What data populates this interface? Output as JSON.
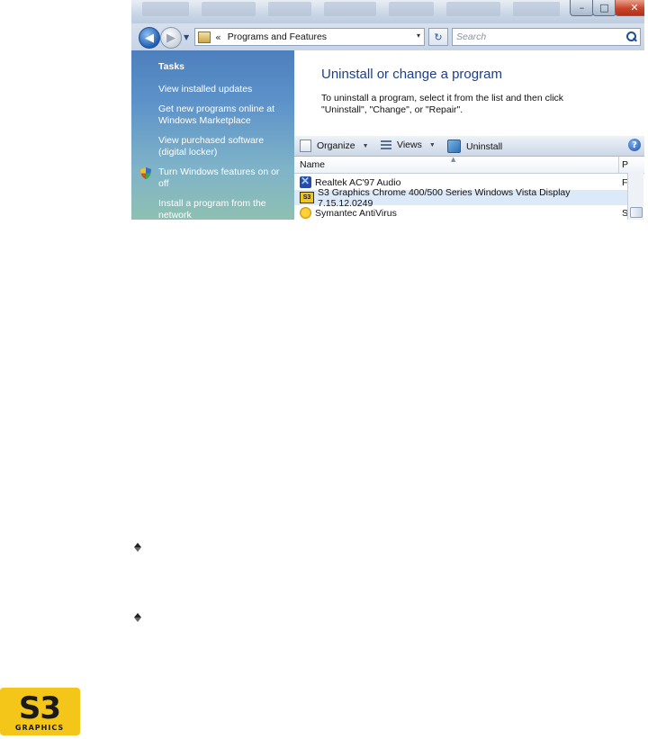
{
  "window": {
    "controls": {
      "minimize": "–",
      "maximize": "□",
      "close": "✕"
    },
    "address": {
      "separator": "«",
      "location": "Programs and Features",
      "dropdown": "▾",
      "refresh": "↻"
    },
    "search": {
      "placeholder": "Search"
    }
  },
  "sidebar": {
    "title": "Tasks",
    "links": [
      {
        "label": "View installed updates"
      },
      {
        "label": "Get new programs online at Windows Marketplace"
      },
      {
        "label": "View purchased software (digital locker)"
      },
      {
        "label": "Turn Windows features on or off"
      },
      {
        "label": "Install a program from the network"
      }
    ]
  },
  "main": {
    "heading": "Uninstall or change a program",
    "description": "To uninstall a program, select it from the list and then click \"Uninstall\", \"Change\", or \"Repair\".",
    "toolbar": {
      "organize": "Organize",
      "views": "Views",
      "uninstall": "Uninstall",
      "help": "?"
    },
    "columns": {
      "name": "Name",
      "second": "P"
    },
    "programs": [
      {
        "name": "Realtek AC'97 Audio",
        "extra": "F",
        "icon": "realtek-icon",
        "selected": false
      },
      {
        "name": "S3 Graphics Chrome 400/500 Series Windows Vista Display 7.15.12.0249",
        "extra": "",
        "icon": "s3-icon",
        "selected": true
      },
      {
        "name": "Symantec AntiVirus",
        "extra": "S",
        "icon": "symantec-icon",
        "selected": false
      }
    ]
  },
  "logo": {
    "brand": "S3",
    "sub": "GRAPHICS",
    "color": "#f4c61a"
  },
  "colors": {
    "accent": "#1d3f8a",
    "sidebar": "#5c92c9",
    "selection": "#dbe9f8"
  }
}
